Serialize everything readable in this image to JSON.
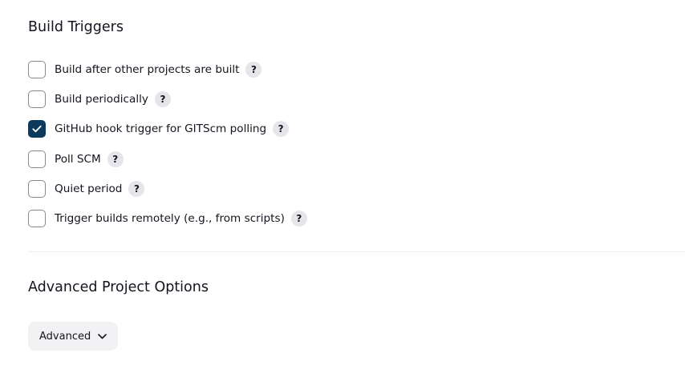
{
  "sections": {
    "build_triggers": {
      "title": "Build Triggers",
      "help_symbol": "?",
      "items": [
        {
          "label": "Build after other projects are built",
          "checked": false
        },
        {
          "label": "Build periodically",
          "checked": false
        },
        {
          "label": "GitHub hook trigger for GITScm polling",
          "checked": true
        },
        {
          "label": "Poll SCM",
          "checked": false
        },
        {
          "label": "Quiet period",
          "checked": false
        },
        {
          "label": "Trigger builds remotely (e.g., from scripts)",
          "checked": false
        }
      ]
    },
    "advanced_project_options": {
      "title": "Advanced Project Options",
      "advanced_button_label": "Advanced"
    }
  },
  "colors": {
    "checkbox_checked": "#0b3a5c",
    "checkbox_border": "#898995",
    "help_badge_bg": "#e6e6ea",
    "button_bg": "#f2f2f4"
  }
}
